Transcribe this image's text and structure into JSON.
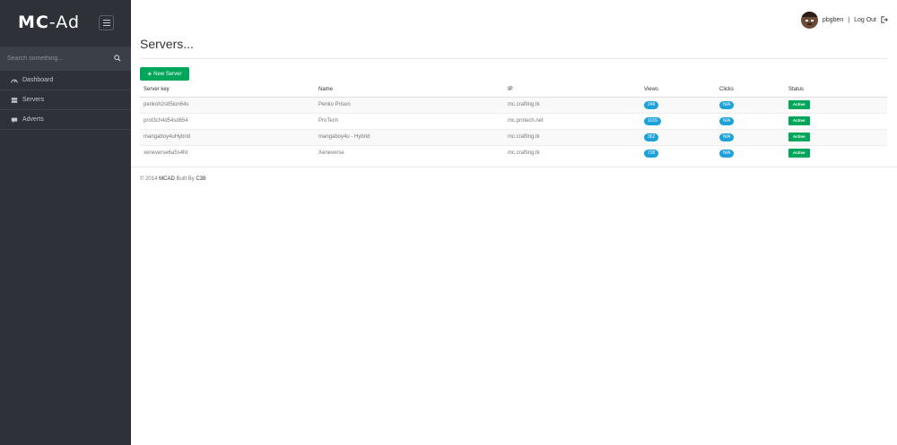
{
  "app": {
    "logo_bold": "MC",
    "logo_rest": "-Ad"
  },
  "sidebar": {
    "search_placeholder": "Search something...",
    "items": [
      {
        "label": "Dashboard",
        "icon": "dashboard-icon"
      },
      {
        "label": "Servers",
        "icon": "server-icon"
      },
      {
        "label": "Adverts",
        "icon": "comment-icon"
      }
    ]
  },
  "user": {
    "name": "pbgben",
    "separator": "|",
    "logout_label": "Log Out"
  },
  "page": {
    "title": "Servers..."
  },
  "toolbar": {
    "new_server_label": "New Server"
  },
  "table": {
    "headers": [
      "Server key",
      "Name",
      "IP",
      "Views",
      "Clicks",
      "Status"
    ],
    "rows": [
      {
        "key": "penkoh2s85ion64s",
        "name": "Penko Prison",
        "ip": "mc.crafting.tk",
        "views": "249",
        "clicks": "N/A",
        "status": "Active"
      },
      {
        "key": "prot3ch4d54sd654",
        "name": "ProTech",
        "ip": "mc.protech.net",
        "views": "1169",
        "clicks": "N/A",
        "status": "Active"
      },
      {
        "key": "mangaboy4uHybrid",
        "name": "mangaboy4u - Hybrid",
        "ip": "mc.crafting.tk",
        "views": "362",
        "clicks": "N/A",
        "status": "Active"
      },
      {
        "key": "xeneverse6a5s4fd",
        "name": "Xeneverse",
        "ip": "mc.crafting.tk",
        "views": "728",
        "clicks": "N/A",
        "status": "Active"
      }
    ]
  },
  "footer": {
    "prefix": "© 2014",
    "product": "MCAD",
    "built_by": "Built By",
    "author": "C38"
  },
  "colors": {
    "sidebar_bg": "#2e3238",
    "accent_green": "#00a65a",
    "badge_blue": "#1da1d9"
  }
}
